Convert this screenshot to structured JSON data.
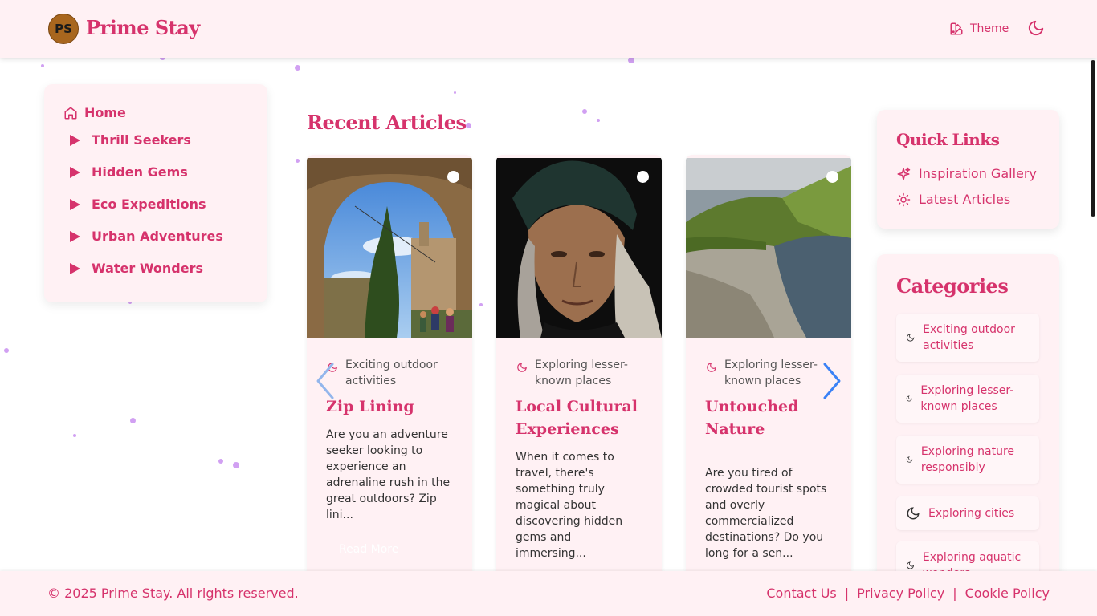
{
  "brand": {
    "initials": "PS",
    "name": "Prime Stay"
  },
  "header": {
    "theme_label": "Theme"
  },
  "sidebar": {
    "home": "Home",
    "items": [
      {
        "label": "Thrill Seekers"
      },
      {
        "label": "Hidden Gems"
      },
      {
        "label": "Eco Expeditions"
      },
      {
        "label": "Urban Adventures"
      },
      {
        "label": "Water Wonders"
      }
    ]
  },
  "main": {
    "section_title": "Recent Articles",
    "read_more": "Read More",
    "articles": [
      {
        "category": "Exciting outdoor activities",
        "title": "Zip Lining",
        "excerpt": "Are you an adventure seeker looking to experience an adrenaline rush in the great outdoors? Zip lini..."
      },
      {
        "category": "Exploring lesser-known places",
        "title": "Local Cultural Experiences",
        "excerpt": "When it comes to travel, there's something truly magical about discovering hidden gems and immersing..."
      },
      {
        "category": "Exploring lesser-known places",
        "title": "Untouched Nature",
        "excerpt": "Are you tired of crowded tourist spots and overly commercialized destinations? Do you long for a sen..."
      }
    ]
  },
  "quick_links": {
    "title": "Quick Links",
    "items": [
      {
        "label": "Inspiration Gallery",
        "icon": "sparkles-icon"
      },
      {
        "label": "Latest Articles",
        "icon": "sun-icon"
      }
    ]
  },
  "categories": {
    "title": "Categories",
    "items": [
      {
        "label": "Exciting outdoor activities"
      },
      {
        "label": "Exploring lesser-known places"
      },
      {
        "label": "Exploring nature responsibly"
      },
      {
        "label": "Exploring cities"
      },
      {
        "label": "Exploring aquatic wonders"
      }
    ]
  },
  "footer": {
    "copyright": "© 2025 Prime Stay. All rights reserved.",
    "links": [
      "Contact Us",
      "Privacy Policy",
      "Cookie Policy"
    ],
    "separator": "|"
  },
  "colors": {
    "accent": "#d6336c",
    "surface": "#fff1f4",
    "arrow": "#3b82f6"
  }
}
